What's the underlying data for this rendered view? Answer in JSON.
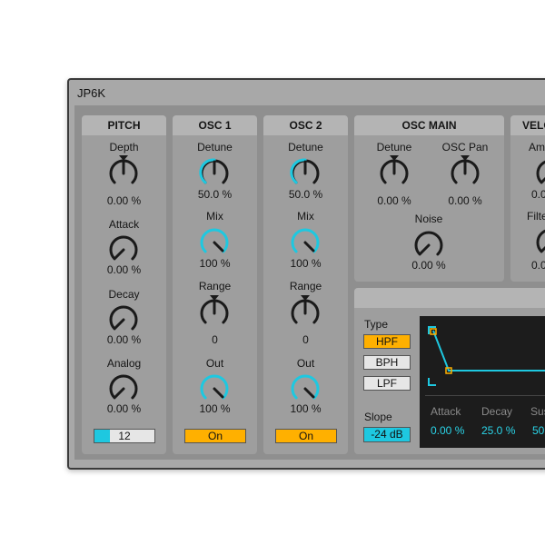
{
  "window": {
    "title": "JP6K"
  },
  "colors": {
    "accent": "#1ec8e0",
    "on": "#ffb000",
    "dark": "#1a1a1a"
  },
  "pitch": {
    "title": "PITCH",
    "depth": {
      "label": "Depth",
      "value": "0.00 %"
    },
    "attack": {
      "label": "Attack",
      "value": "0.00 %"
    },
    "decay": {
      "label": "Decay",
      "value": "0.00 %"
    },
    "analog": {
      "label": "Analog",
      "value": "0.00 %"
    },
    "number": {
      "value": "12"
    }
  },
  "osc1": {
    "title": "OSC 1",
    "detune": {
      "label": "Detune",
      "value": "50.0 %"
    },
    "mix": {
      "label": "Mix",
      "value": "100 %"
    },
    "range": {
      "label": "Range",
      "value": "0"
    },
    "out": {
      "label": "Out",
      "value": "100 %"
    },
    "toggle": "On"
  },
  "osc2": {
    "title": "OSC 2",
    "detune": {
      "label": "Detune",
      "value": "50.0 %"
    },
    "mix": {
      "label": "Mix",
      "value": "100 %"
    },
    "range": {
      "label": "Range",
      "value": "0"
    },
    "out": {
      "label": "Out",
      "value": "100 %"
    },
    "toggle": "On"
  },
  "osc_main": {
    "title": "OSC MAIN",
    "detune": {
      "label": "Detune",
      "value": "0.00 %"
    },
    "pan": {
      "label": "OSC Pan",
      "value": "0.00 %"
    },
    "noise": {
      "label": "Noise",
      "value": "0.00 %"
    }
  },
  "velo": {
    "title": "VELO",
    "amp": {
      "label": "Am",
      "value": "0.0"
    },
    "filter": {
      "label": "Filte",
      "value": "0.0"
    }
  },
  "filter": {
    "type_label": "Type",
    "types": [
      "HPF",
      "BPH",
      "LPF"
    ],
    "selected": "HPF",
    "slope_label": "Slope",
    "slope_value": "-24 dB"
  },
  "envelope": {
    "attack": {
      "label": "Attack",
      "value": "0.00 %"
    },
    "decay": {
      "label": "Decay",
      "value": "25.0 %"
    },
    "sustain": {
      "label": "Sus",
      "value": "50"
    }
  }
}
